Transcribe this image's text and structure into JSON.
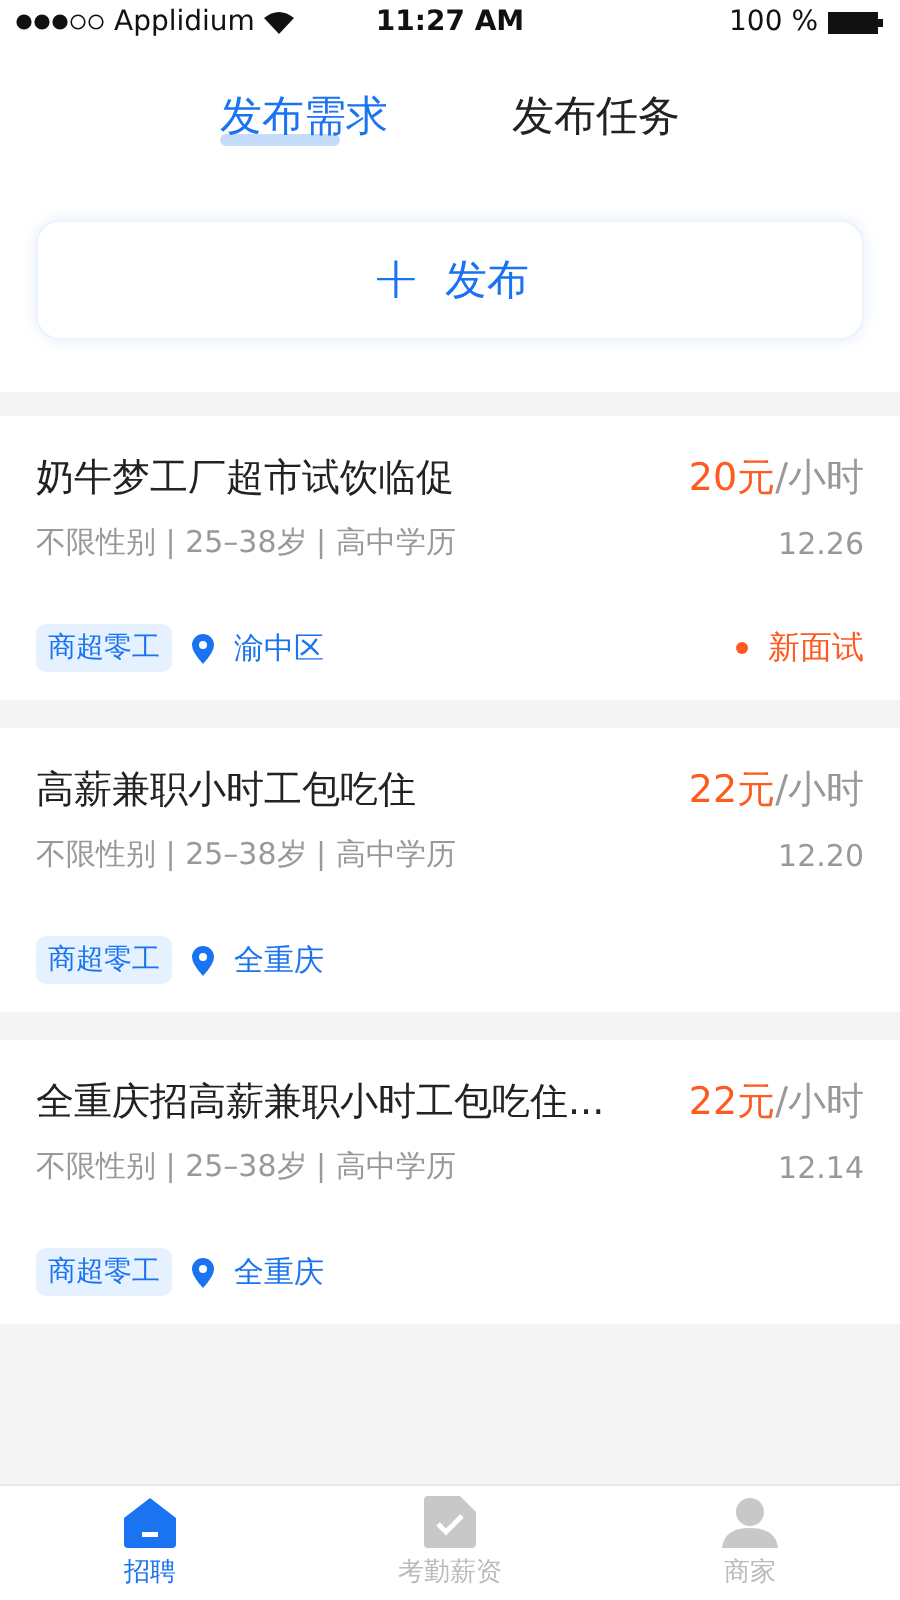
{
  "status_bar": {
    "carrier": "Applidium",
    "time": "11:27 AM",
    "battery": "100 %"
  },
  "tabs": [
    {
      "label": "发布需求",
      "selected": true
    },
    {
      "label": "发布任务",
      "selected": false
    }
  ],
  "publish_button": {
    "icon": "+",
    "label": "发布"
  },
  "jobs": [
    {
      "title": "奶牛梦工厂超市试饮临促",
      "price": "20元",
      "unit": "/小时",
      "meta": "不限性别 | 25–38岁 | 高中学历",
      "date": "12.26",
      "tag": "商超零工",
      "location": "渝中区",
      "status": "新面试"
    },
    {
      "title": "高薪兼职小时工包吃住",
      "price": "22元",
      "unit": "/小时",
      "meta": "不限性别 | 25–38岁 | 高中学历",
      "date": "12.20",
      "tag": "商超零工",
      "location": "全重庆"
    },
    {
      "title": "全重庆招高薪兼职小时工包吃住...",
      "price": "22元",
      "unit": "/小时",
      "meta": "不限性别 | 25–38岁 | 高中学历",
      "date": "12.14",
      "tag": "商超零工",
      "location": "全重庆"
    }
  ],
  "bottom_nav": [
    {
      "kind": "home",
      "label": "招聘",
      "selected": true
    },
    {
      "kind": "document",
      "label": "考勤薪资",
      "selected": false
    },
    {
      "kind": "person",
      "label": "商家",
      "selected": false
    }
  ]
}
